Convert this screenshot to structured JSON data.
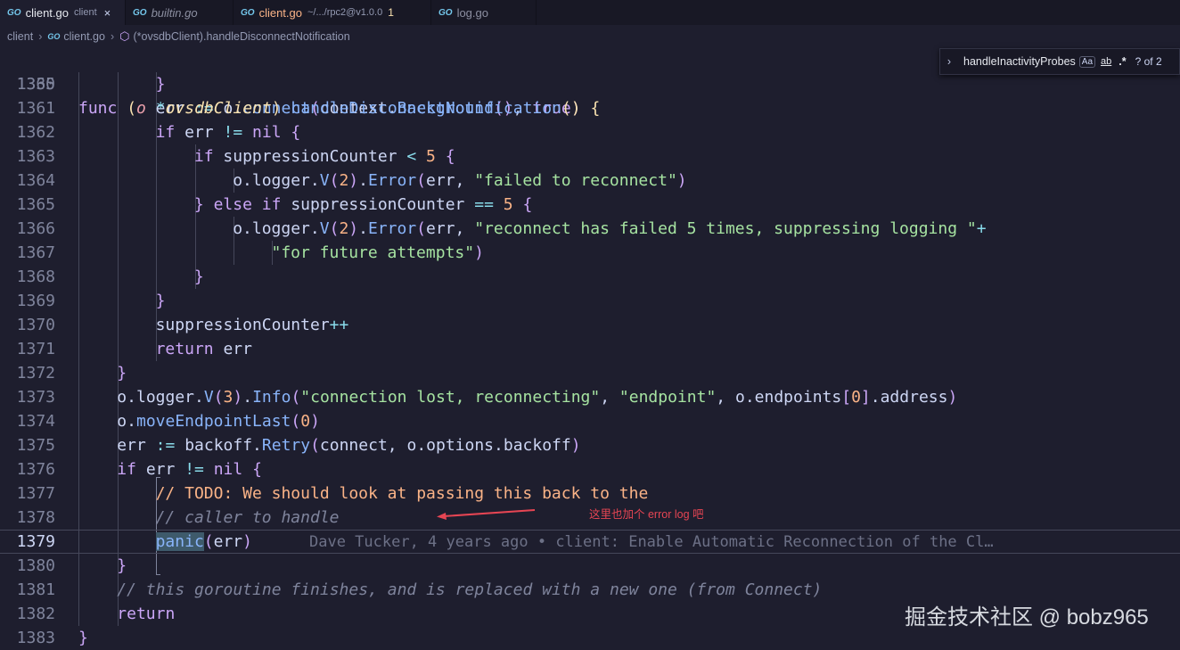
{
  "tabs": [
    {
      "icon": "go-file-icon",
      "name": "client.go",
      "desc": "client",
      "close": "×",
      "active": true
    },
    {
      "icon": "go-file-icon",
      "name": "builtin.go",
      "desc": "",
      "active": false,
      "italic": true
    },
    {
      "icon": "go-file-icon",
      "name": "client.go",
      "desc": "~/.../rpc2@v1.0.0",
      "badge": "1",
      "active": false
    },
    {
      "icon": "go-file-icon",
      "name": "log.go",
      "desc": "",
      "active": false
    }
  ],
  "breadcrumb": {
    "folder": "client",
    "file": "client.go",
    "symbol": "(*ovsdbClient).handleDisconnectNotification",
    "separator": "›"
  },
  "find_widget": {
    "query": "handleInactivityProbes",
    "match_case": "Aa",
    "whole_word": "ab",
    "regex": ".*",
    "result": "? of 2"
  },
  "code": {
    "sticky_line": {
      "n": "1335",
      "text": "func (o *ovsdbClient) handleDisconnectNotification() {"
    },
    "lines": [
      {
        "n": "1360",
        "text": "}"
      },
      {
        "n": "1361",
        "text": "err := o.connect(context.Background(), true)"
      },
      {
        "n": "1362",
        "text": "if err != nil {"
      },
      {
        "n": "1363",
        "text": "if suppressionCounter < 5 {"
      },
      {
        "n": "1364",
        "text": "o.logger.V(2).Error(err, \"failed to reconnect\")"
      },
      {
        "n": "1365",
        "text": "} else if suppressionCounter == 5 {"
      },
      {
        "n": "1366",
        "text": "o.logger.V(2).Error(err, \"reconnect has failed 5 times, suppressing logging \"+"
      },
      {
        "n": "1367",
        "text": "\"for future attempts\")"
      },
      {
        "n": "1368",
        "text": "}"
      },
      {
        "n": "1369",
        "text": "}"
      },
      {
        "n": "1370",
        "text": "suppressionCounter++"
      },
      {
        "n": "1371",
        "text": "return err"
      },
      {
        "n": "1372",
        "text": "}"
      },
      {
        "n": "1373",
        "text": "o.logger.V(3).Info(\"connection lost, reconnecting\", \"endpoint\", o.endpoints[0].address)"
      },
      {
        "n": "1374",
        "text": "o.moveEndpointLast(0)"
      },
      {
        "n": "1375",
        "text": "err := backoff.Retry(connect, o.options.backoff)"
      },
      {
        "n": "1376",
        "text": "if err != nil {"
      },
      {
        "n": "1377",
        "text": "// TODO: We should look at passing this back to the"
      },
      {
        "n": "1378",
        "text": "// caller to handle"
      },
      {
        "n": "1379",
        "text": "panic(err)"
      },
      {
        "n": "1380",
        "text": "}"
      },
      {
        "n": "1381",
        "text": "// this goroutine finishes, and is replaced with a new one (from Connect)"
      },
      {
        "n": "1382",
        "text": "return"
      },
      {
        "n": "1383",
        "text": "}"
      }
    ],
    "blame": "Dave Tucker, 4 years ago • client: Enable Automatic Reconnection of the Cl…"
  },
  "annotation": "这里也加个 error log 吧",
  "watermark": "掘金技术社区 @ bobz965",
  "colors": {
    "background": "#1e1e2e",
    "keyword": "#cba6f7",
    "function": "#89b4fa",
    "string": "#a6e3a1",
    "number": "#fab387",
    "comment": "#7f849c",
    "annotation": "#e64553"
  }
}
